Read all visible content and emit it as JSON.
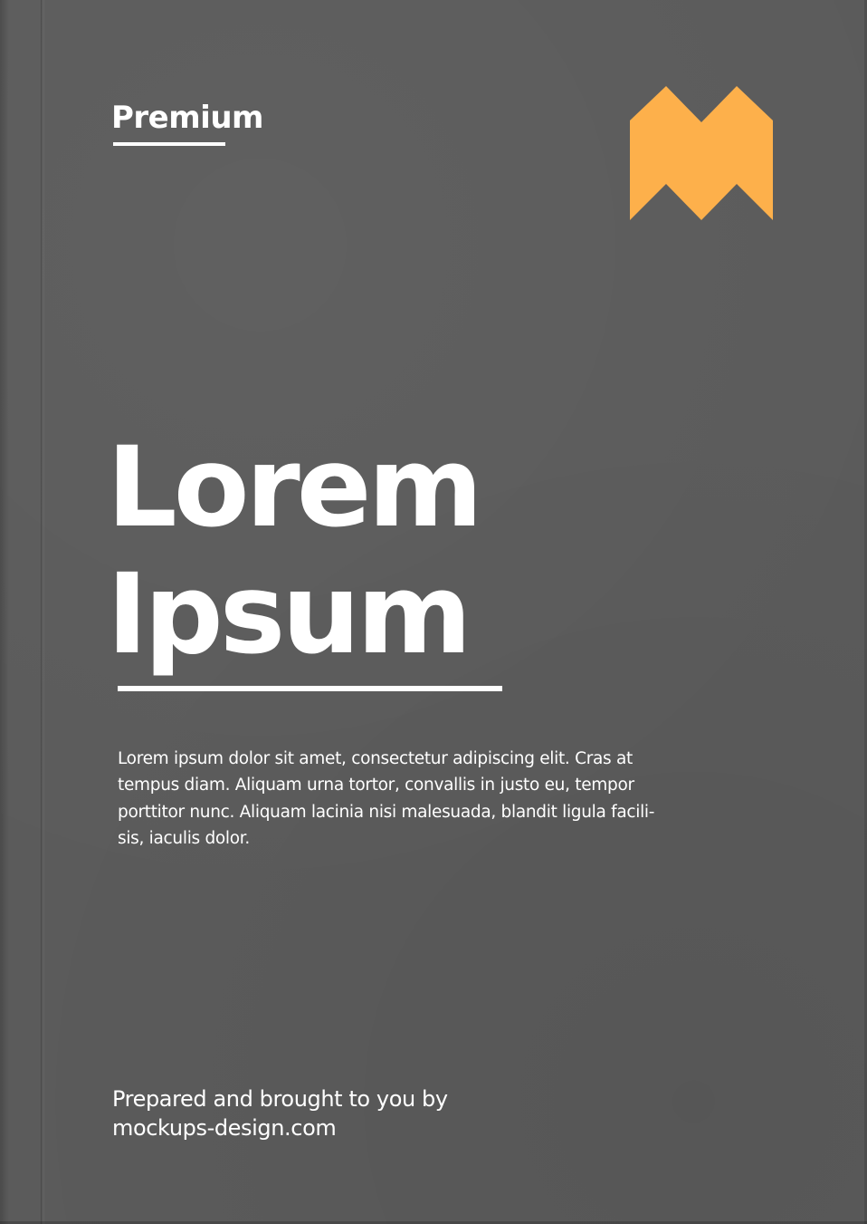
{
  "cover": {
    "label": "Premium",
    "title_line1": "Lorem",
    "title_line2": "Ipsum",
    "body_lines": [
      "Lorem ipsum dolor sit amet, consectetur adipiscing elit. Cras at",
      "tempus diam. Aliquam urna tortor, convallis in justo eu, tempor",
      "porttitor nunc. Aliquam lacinia nisi malesuada, blandit ligula facili-",
      "sis, iaculis dolor."
    ],
    "credit_line1": "Prepared and brought to you by",
    "credit_line2": "mockups-design.com"
  },
  "logo": {
    "icon": "m-chevron-logo-icon",
    "color": "#fdb04b"
  },
  "colors": {
    "background": "#5b5b5b",
    "text": "#ffffff"
  }
}
